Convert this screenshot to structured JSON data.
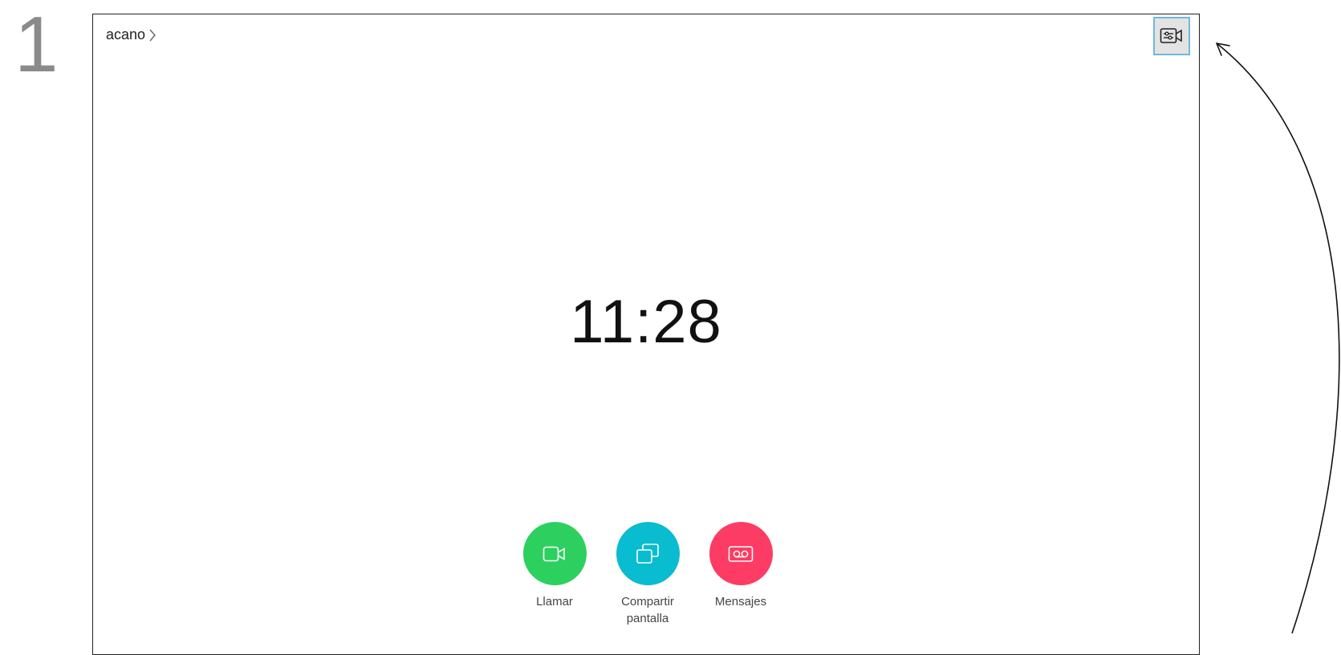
{
  "step_number": "1",
  "header": {
    "breadcrumb_label": "acano",
    "chevron_icon": "chevron-right-icon",
    "camera_control_icon": "camera-settings-icon"
  },
  "clock": {
    "time": "11:28"
  },
  "actions": [
    {
      "label": "Llamar",
      "icon": "video-camera-icon",
      "color": "#2dd05f"
    },
    {
      "label": "Compartir pantalla",
      "icon": "share-screen-icon",
      "color": "#09bccf"
    },
    {
      "label": "Mensajes",
      "icon": "voicemail-icon",
      "color": "#fc3c64"
    }
  ],
  "colors": {
    "frame": "#222222",
    "selected_button_border": "#6fb8e0",
    "step_number": "#8a8a8a"
  }
}
